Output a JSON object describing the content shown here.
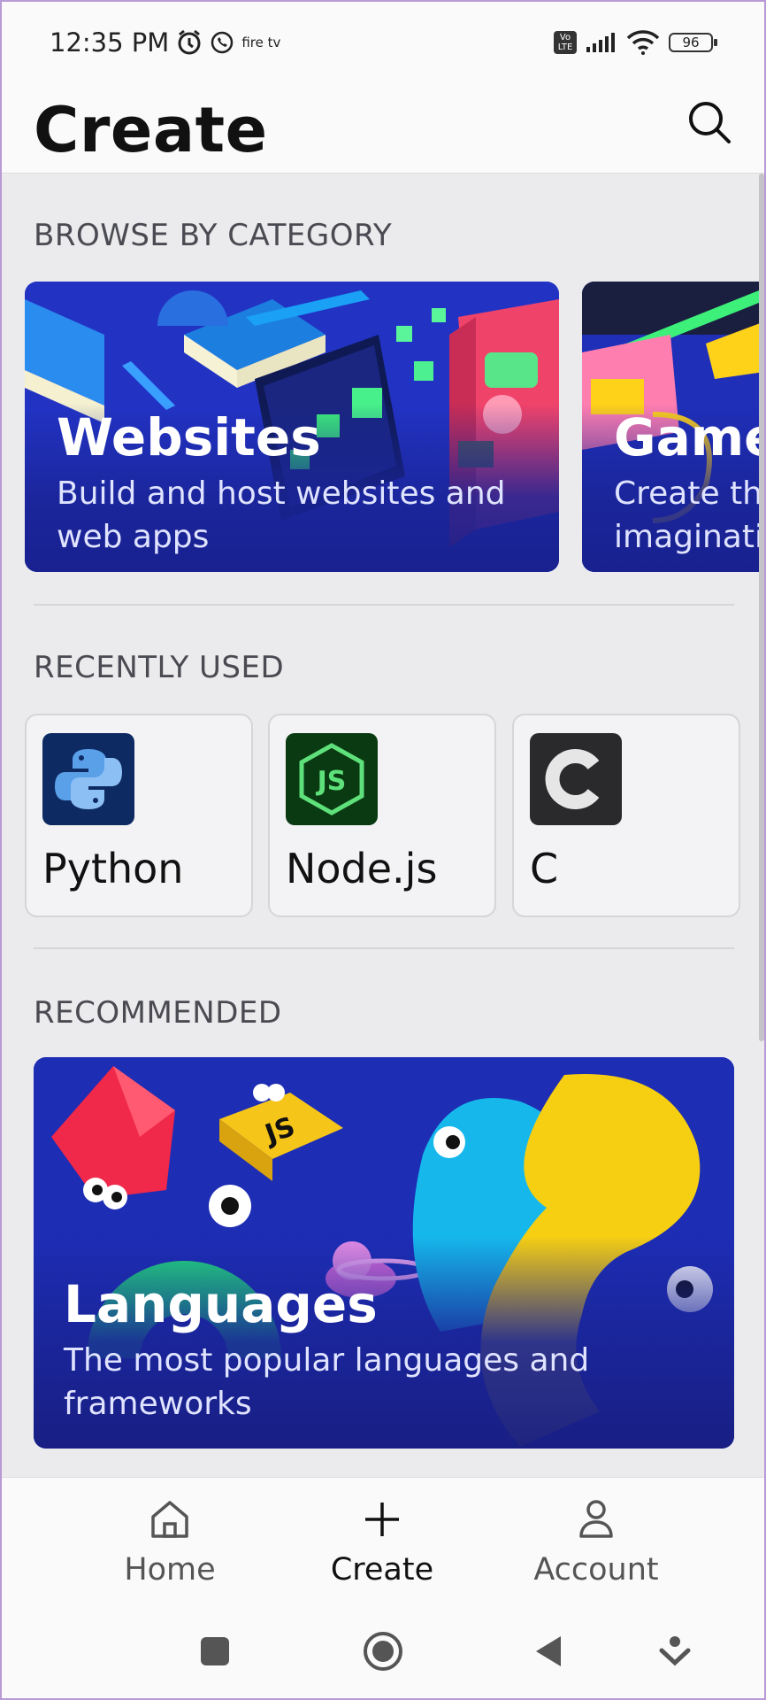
{
  "status_bar": {
    "time": "12:35 PM",
    "firetv_label": "fire tv",
    "volte_label": "Vo LTE",
    "battery": "96"
  },
  "header": {
    "title": "Create"
  },
  "sections": {
    "browse_label": "BROWSE BY CATEGORY",
    "recent_label": "RECENTLY USED",
    "recommended_label": "RECOMMENDED"
  },
  "categories": [
    {
      "title": "Websites",
      "description": "Build and host websites and web apps"
    },
    {
      "title": "Games",
      "description": "Create the games of your imagination"
    }
  ],
  "recent": [
    {
      "label": "Python"
    },
    {
      "label": "Node.js"
    },
    {
      "label": "C"
    }
  ],
  "recommended": {
    "title": "Languages",
    "description": "The most popular languages and frameworks"
  },
  "bottom_nav": [
    {
      "label": "Home"
    },
    {
      "label": "Create"
    },
    {
      "label": "Account"
    }
  ],
  "colors": {
    "card_blue": "#1f2fb8",
    "background": "#ebebed"
  }
}
